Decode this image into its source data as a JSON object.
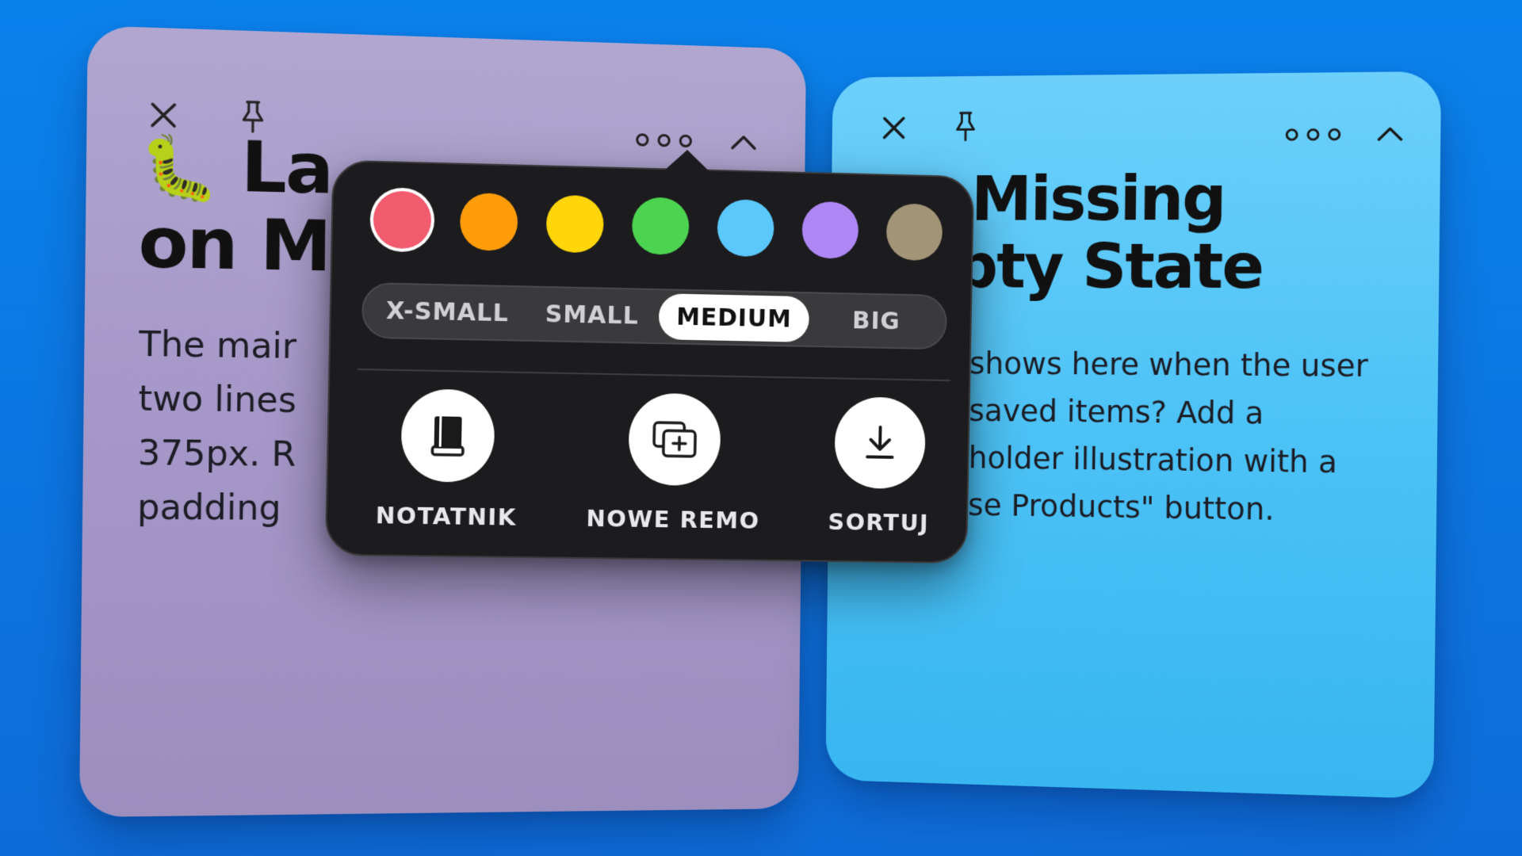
{
  "colors": {
    "background": "#0b7ae8",
    "card_purple": "#a99ccb",
    "card_blue": "#4cc2f6",
    "popover": "#1c1c1e"
  },
  "cards": [
    {
      "name": "purple",
      "title_emoji": "🐛",
      "title_line1": "La",
      "title_line2": "on M",
      "body_lines": [
        "The mair",
        "two lines",
        "375px. R",
        "padding"
      ],
      "icons": [
        "close-icon",
        "pin-icon",
        "more-icon",
        "chevron-up-icon"
      ]
    },
    {
      "name": "blue",
      "title_line1": "Missing",
      "title_line2": "pty State",
      "body_lines": [
        "shows here when the user",
        "saved items? Add a",
        "holder illustration with a",
        "se Products\" button."
      ],
      "icons": [
        "close-icon",
        "pin-icon",
        "more-icon",
        "chevron-up-icon"
      ]
    }
  ],
  "popover": {
    "swatches": [
      {
        "name": "red",
        "color": "#f25a6e",
        "selected": true
      },
      {
        "name": "orange",
        "color": "#ff9c0a"
      },
      {
        "name": "yellow",
        "color": "#ffd60a"
      },
      {
        "name": "green",
        "color": "#4cd34f"
      },
      {
        "name": "blue",
        "color": "#5ac8fa"
      },
      {
        "name": "purple",
        "color": "#af87f5"
      },
      {
        "name": "brown",
        "color": "#a29477"
      }
    ],
    "sizes": [
      {
        "label": "X-SMALL"
      },
      {
        "label": "SMALL"
      },
      {
        "label": "MEDIUM",
        "active": true
      },
      {
        "label": "BIG"
      }
    ],
    "actions": [
      {
        "label": "NOTATNIK",
        "icon": "notebook-icon"
      },
      {
        "label": "NOWE REMO",
        "icon": "new-memo-icon"
      },
      {
        "label": "SORTUJ",
        "icon": "download-arrow-icon"
      }
    ]
  }
}
